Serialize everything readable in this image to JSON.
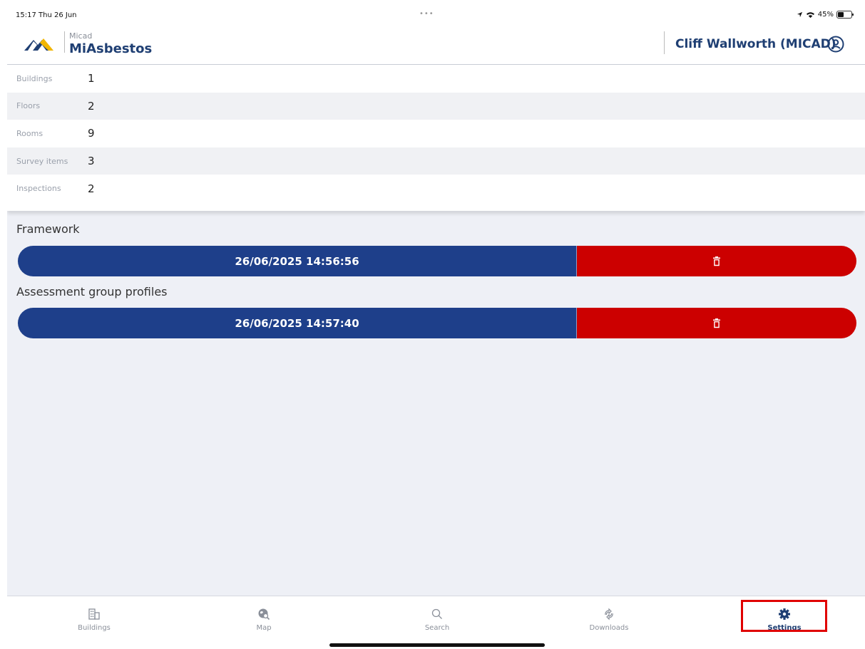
{
  "status_bar": {
    "time": "15:17  Thu 26 Jun",
    "dots": "•••",
    "battery_text": "45%",
    "battery_level": 0.45
  },
  "header": {
    "brand_small": "Micad",
    "brand_name": "MiAsbestos",
    "user_name": "Cliff Wallworth (MICAD)",
    "logo_colors": [
      "#1f3f73",
      "#f2b600"
    ]
  },
  "stats": [
    {
      "label": "Buildings",
      "value": "1"
    },
    {
      "label": "Floors",
      "value": "2"
    },
    {
      "label": "Rooms",
      "value": "9"
    },
    {
      "label": "Survey items",
      "value": "3"
    },
    {
      "label": "Inspections",
      "value": "2"
    }
  ],
  "downloads": [
    {
      "title": "Framework",
      "timestamp": "26/06/2025 14:56:56"
    },
    {
      "title": "Assessment group profiles",
      "timestamp": "26/06/2025 14:57:40"
    }
  ],
  "tabs": [
    {
      "label": "Buildings",
      "icon": "building-icon"
    },
    {
      "label": "Map",
      "icon": "map-icon"
    },
    {
      "label": "Search",
      "icon": "search-icon"
    },
    {
      "label": "Downloads",
      "icon": "sync-icon"
    },
    {
      "label": "Settings",
      "icon": "gear-icon",
      "active": true
    }
  ],
  "colors": {
    "primary": "#1e3f8a",
    "danger": "#cc0000",
    "highlight": "#e00000"
  }
}
